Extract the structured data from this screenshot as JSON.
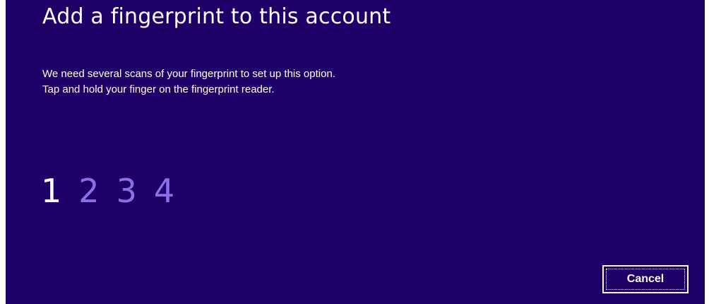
{
  "dialog": {
    "title": "Add a fingerprint to this account",
    "description_lines": [
      "We need several scans of your fingerprint to set up this option.",
      "Tap and hold your finger on the fingerprint reader."
    ],
    "steps": [
      {
        "label": "1",
        "state": "active"
      },
      {
        "label": "2",
        "state": "pending"
      },
      {
        "label": "3",
        "state": "pending"
      },
      {
        "label": "4",
        "state": "pending"
      }
    ],
    "current_step": 1,
    "cancel_label": "Cancel"
  },
  "colors": {
    "background": "#1f0068",
    "text": "#ffffff",
    "pending_step": "#8a70e8"
  }
}
